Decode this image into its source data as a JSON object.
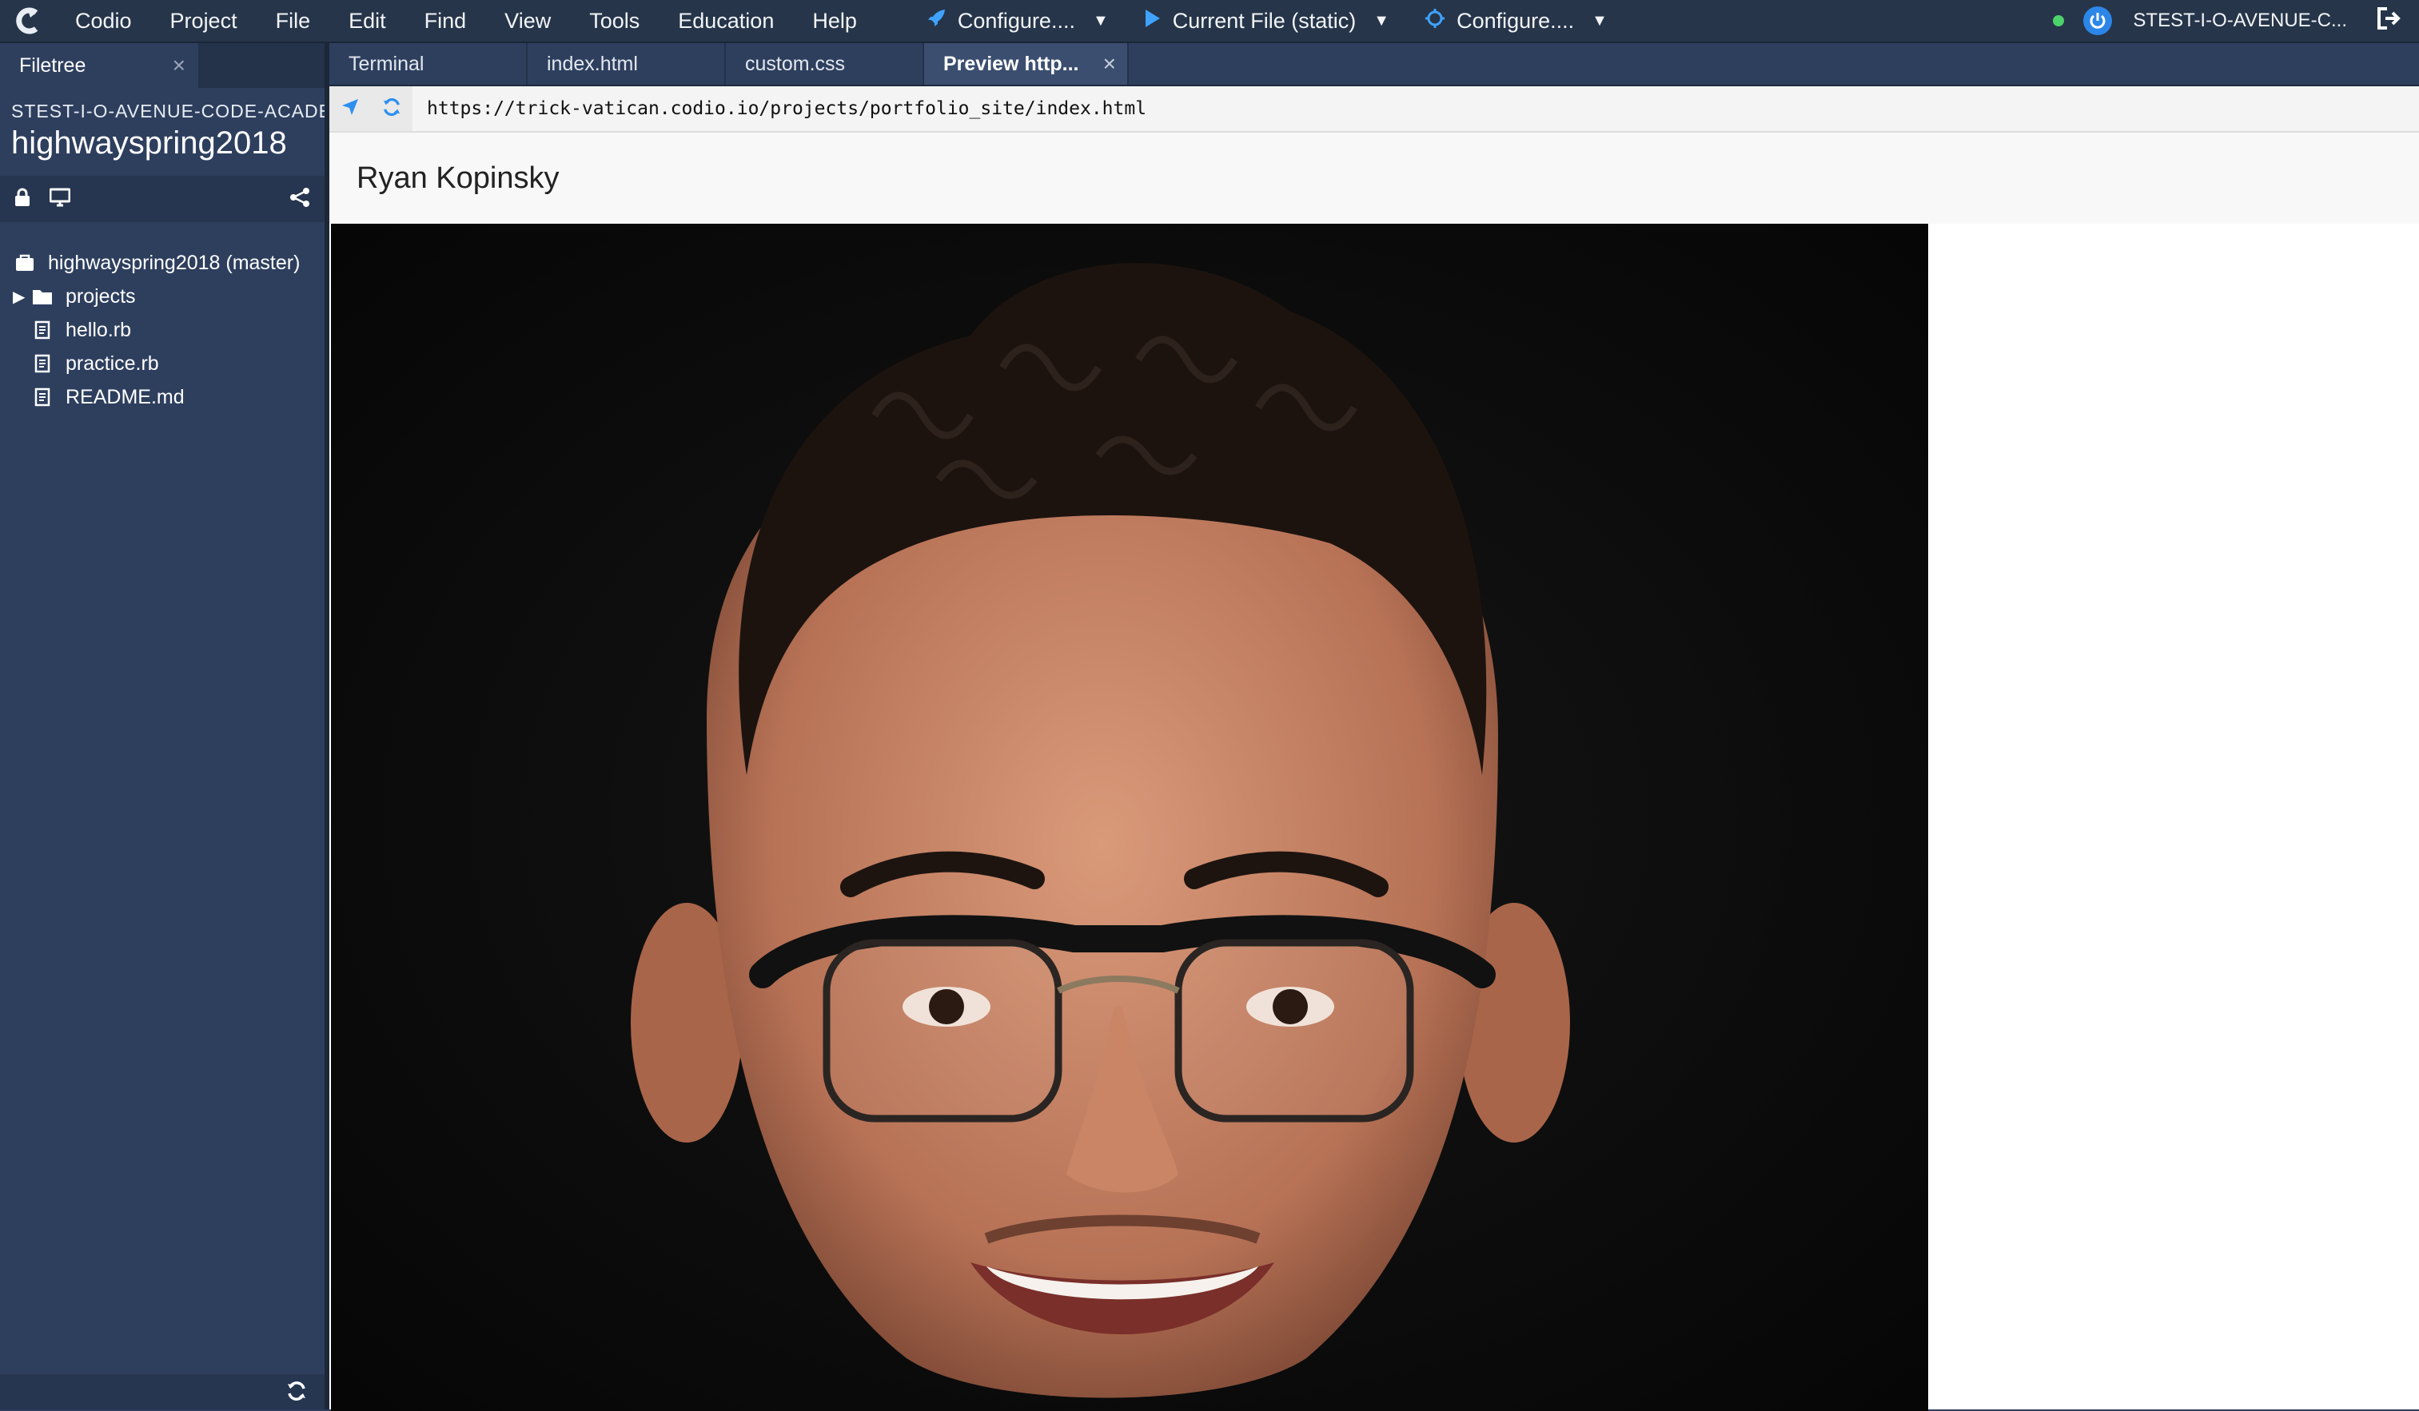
{
  "menubar": {
    "items": [
      "Codio",
      "Project",
      "File",
      "Edit",
      "Find",
      "View",
      "Tools",
      "Education",
      "Help"
    ],
    "configure_preview": "Configure....",
    "run_current_file": "Current File (static)",
    "configure_debug": "Configure....",
    "user": "STEST-I-O-AVENUE-C..."
  },
  "sidebar": {
    "tab_label": "Filetree",
    "project_owner": "STEST-I-O-AVENUE-CODE-ACADEMY",
    "project_name": "highwayspring2018",
    "tree": [
      {
        "label": "highwayspring2018 (master)",
        "icon": "repo-icon"
      },
      {
        "label": "projects",
        "icon": "folder-icon"
      },
      {
        "label": "hello.rb",
        "icon": "file-icon"
      },
      {
        "label": "practice.rb",
        "icon": "file-icon"
      },
      {
        "label": "README.md",
        "icon": "file-icon"
      }
    ]
  },
  "tabs": [
    "Terminal",
    "index.html",
    "custom.css",
    "Preview http..."
  ],
  "preview": {
    "url": "https://trick-vatican.codio.io/projects/portfolio_site/index.html",
    "heading": "Ryan Kopinsky"
  },
  "colors": {
    "menubar_bg": "#263549",
    "sidebar_bg": "#2e3f5e",
    "accent_blue": "#3fa2ff",
    "status_green": "#4cd26b"
  }
}
